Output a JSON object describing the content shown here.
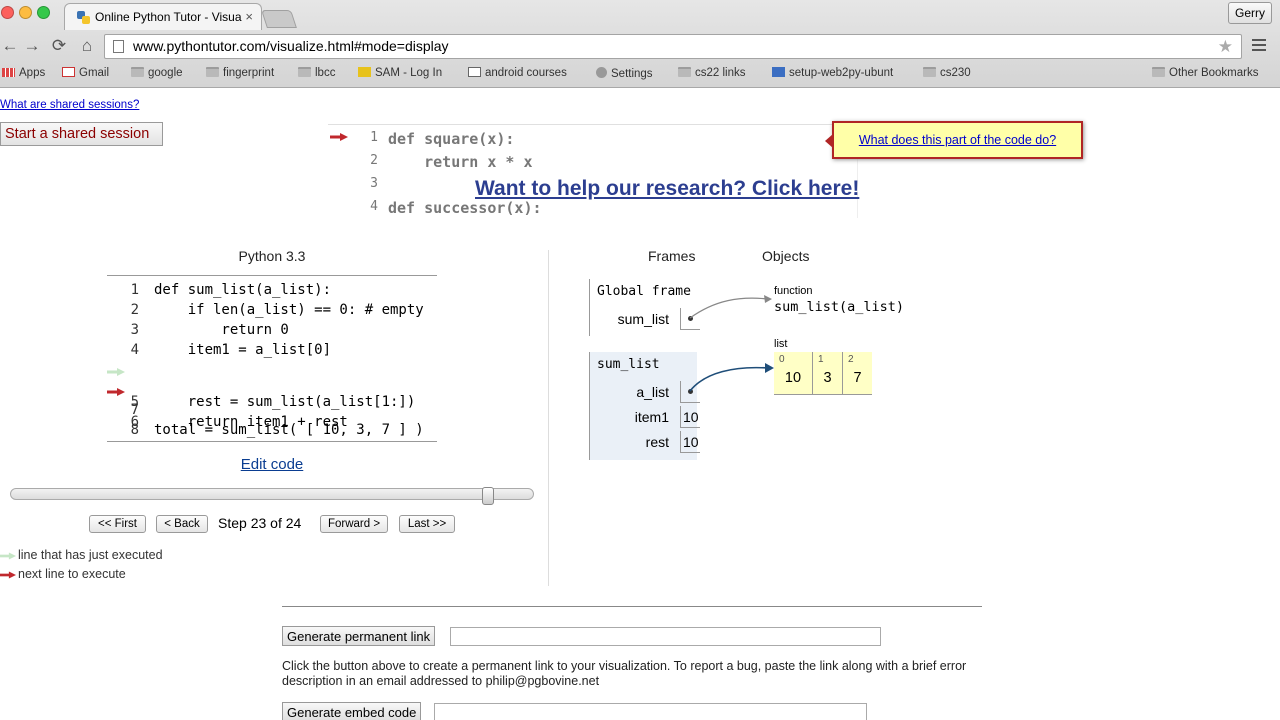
{
  "browser": {
    "tab_title": "Online Python Tutor - Visua",
    "tab_close": "×",
    "profile": "Gerry",
    "nav": {
      "back": "←",
      "forward": "→",
      "reload": "⟳",
      "home": "⌂"
    },
    "url": "www.pythontutor.com/visualize.html#mode=display",
    "star": "★",
    "bookmarks": [
      "Apps",
      "Gmail",
      "google",
      "fingerprint",
      "lbcc",
      "SAM - Log In",
      "android courses",
      "Settings",
      "cs22 links",
      "setup-web2py-ubunt",
      "cs230"
    ],
    "other_bookmarks": "Other Bookmarks"
  },
  "shared": {
    "link": "What are shared sessions?",
    "button": "Start a shared session"
  },
  "preview": {
    "lines": [
      {
        "num": "1",
        "text": "def square(x):"
      },
      {
        "num": "2",
        "text": "    return x * x"
      },
      {
        "num": "3",
        "text": ""
      },
      {
        "num": "4",
        "text": "def successor(x):"
      }
    ]
  },
  "research_link": "Want to help our research? Click here!",
  "callout": "What does this part of the code do?",
  "code": {
    "language": "Python 3.3",
    "lines": [
      {
        "num": "1",
        "text": "def sum_list(a_list):"
      },
      {
        "num": "2",
        "text": "    if len(a_list) == 0: # empty"
      },
      {
        "num": "3",
        "text": "        return 0"
      },
      {
        "num": "4",
        "text": "    item1 = a_list[0]"
      },
      {
        "num": "5",
        "text": "    rest = sum_list(a_list[1:])"
      },
      {
        "num": "6",
        "text": "    return item1 + rest"
      },
      {
        "num": "7",
        "text": ""
      },
      {
        "num": "8",
        "text": "total = sum_list( [ 10, 3, 7 ] )"
      }
    ],
    "just_executed_line": 5,
    "next_line": 6,
    "edit_link": "Edit code"
  },
  "navigation": {
    "first": "<< First",
    "back": "< Back",
    "step_label": "Step 23 of 24",
    "forward": "Forward >",
    "last": "Last >>",
    "current_step": 23,
    "total_steps": 24
  },
  "legend": {
    "just_executed": "line that has just executed",
    "next_to_execute": "next line to execute"
  },
  "visualization": {
    "frames_header": "Frames",
    "objects_header": "Objects",
    "global_frame": {
      "title": "Global frame",
      "vars": [
        {
          "name": "sum_list",
          "value": ""
        }
      ]
    },
    "active_frame": {
      "title": "sum_list",
      "vars": [
        {
          "name": "a_list",
          "value": ""
        },
        {
          "name": "item1",
          "value": "10"
        },
        {
          "name": "rest",
          "value": "10"
        }
      ]
    },
    "function_object": {
      "type": "function",
      "name": "sum_list(a_list)"
    },
    "list_object": {
      "type": "list",
      "items": [
        {
          "index": "0",
          "value": "10"
        },
        {
          "index": "1",
          "value": "3"
        },
        {
          "index": "2",
          "value": "7"
        }
      ]
    }
  },
  "bottom": {
    "permalink_button": "Generate permanent link",
    "bug_text": "Click the button above to create a permanent link to your visualization. To report a bug, paste the link along with a brief error description in an email addressed to philip@pgbovine.net",
    "embed_button": "Generate embed code"
  },
  "colors": {
    "just_executed_arrow": "#c6e6c6",
    "next_line_arrow": "#c0282d",
    "list_cell": "#ffffc6",
    "frame_bg": "#eaf0f7",
    "callout_bg": "#ffffa8"
  }
}
